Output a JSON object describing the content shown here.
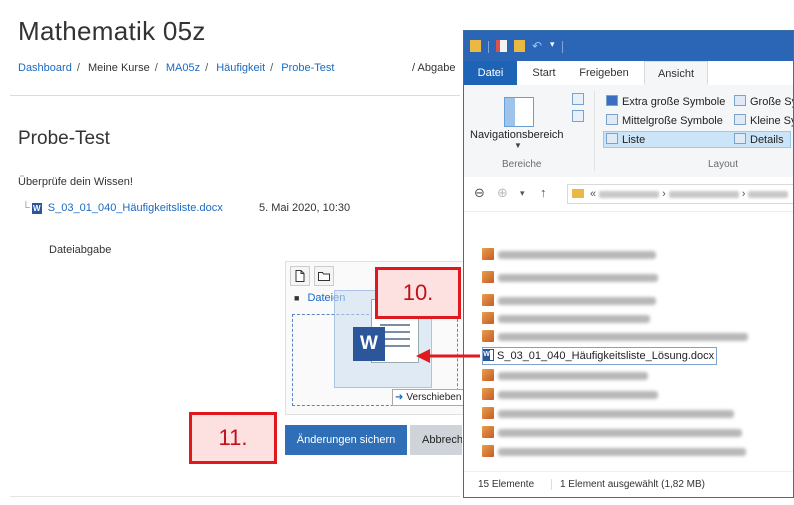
{
  "moodle": {
    "page_title": "Mathematik 05z",
    "breadcrumb": [
      "Dashboard",
      "Meine Kurse",
      "MA05z",
      "Häufigkeit",
      "Probe-Test"
    ],
    "breadcrumb_right": "/ Abgabe",
    "section_title": "Probe-Test",
    "intro": "Überprüfe dein Wissen!",
    "attached_file": "S_03_01_040_Häufigkeitsliste.docx",
    "attached_date": "5. Mai 2020, 10:30",
    "submission_label": "Dateiabgabe",
    "filemanager": {
      "path_label": "Dateien",
      "icons": [
        "new-file-icon",
        "new-folder-icon"
      ]
    },
    "drag_hint": "Verschieben",
    "save_button": "Änderungen sichern",
    "cancel_button": "Abbrechen"
  },
  "callouts": {
    "step10": "10.",
    "step11": "11."
  },
  "explorer": {
    "ribbon_tabs": [
      "Datei",
      "Start",
      "Freigeben",
      "Ansicht"
    ],
    "active_tab": "Ansicht",
    "nav_pane_label": "Navigationsbereich",
    "group_bereiche": "Bereiche",
    "group_layout": "Layout",
    "layout_options": {
      "extra_large": "Extra große Symbole",
      "large": "Große Sy",
      "medium": "Mittelgroße Symbole",
      "small": "Kleine Sy",
      "list": "Liste",
      "details": "Details"
    },
    "address_prefix": "«",
    "selected_file": "S_03_01_040_Häufigkeitsliste_Lösung.docx",
    "status_count": "15 Elemente",
    "status_selected": "1 Element ausgewählt (1,82 MB)"
  },
  "colors": {
    "moodle_blue": "#1a6ac2",
    "primary_button": "#2f6fb8",
    "callout_red": "#e0191e",
    "explorer_blue": "#2a66b5"
  }
}
